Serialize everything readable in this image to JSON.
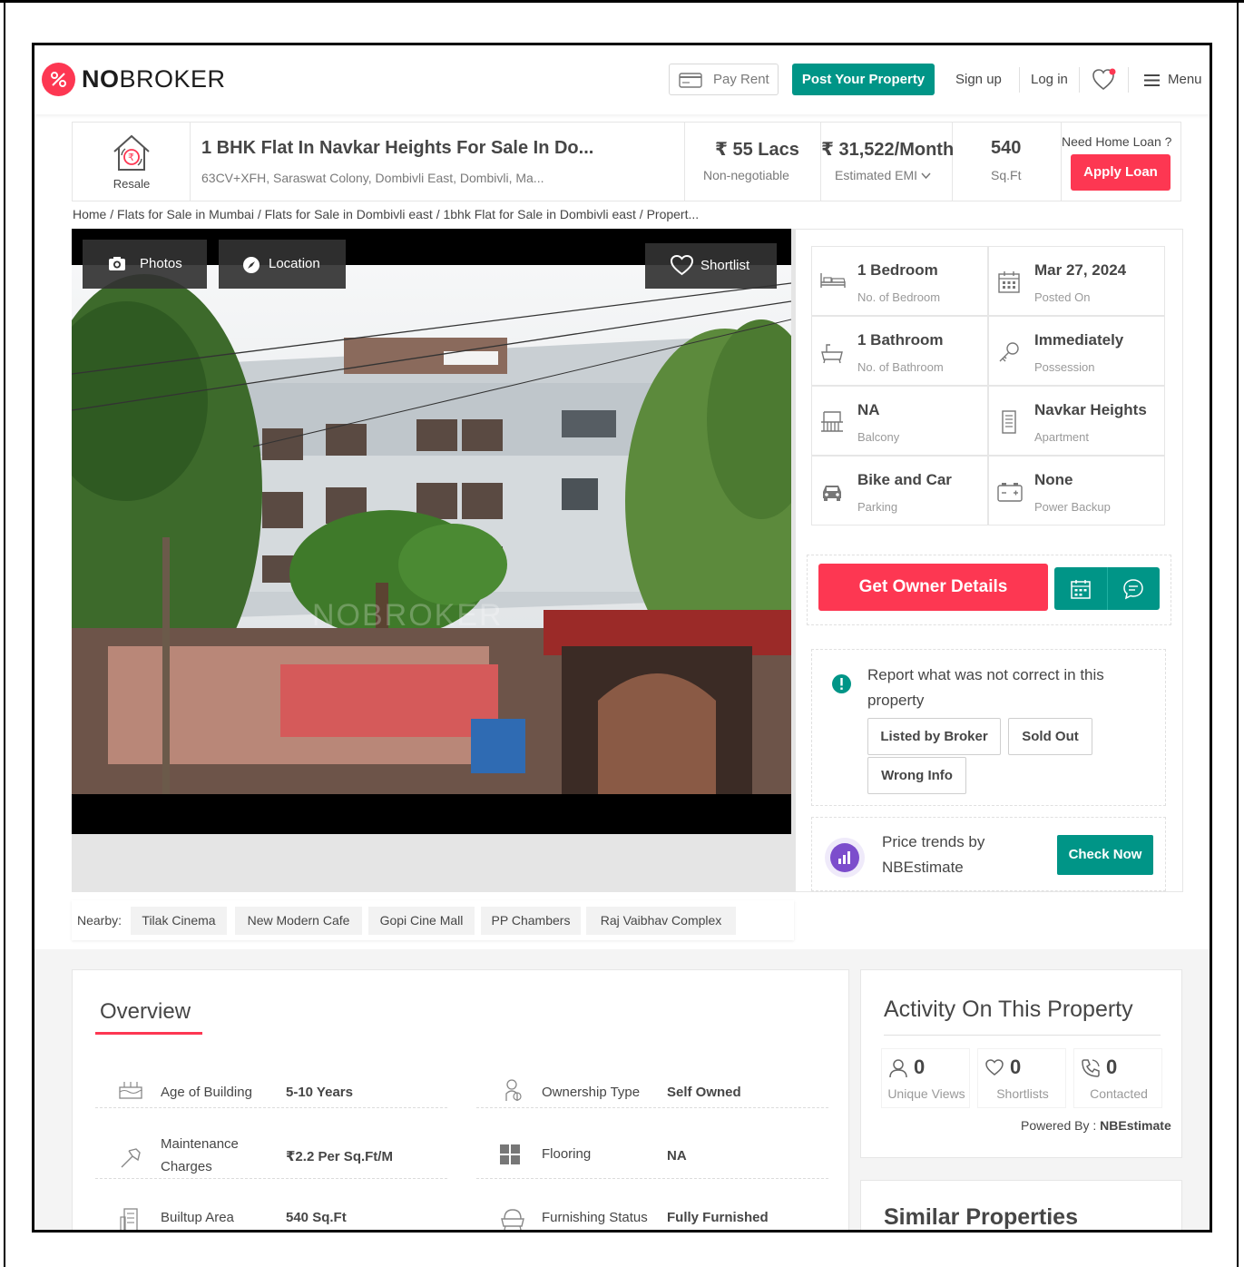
{
  "header": {
    "logo": "NOBROKER",
    "logo_bold": "NO",
    "logo_rest": "BROKER",
    "pay_rent": "Pay Rent",
    "post_property": "Post Your Property",
    "sign_up": "Sign up",
    "log_in": "Log in",
    "menu": "Menu"
  },
  "property": {
    "type_badge": "Resale",
    "title": "1 BHK Flat In Navkar Heights For Sale In Do...",
    "address": "63CV+XFH, Saraswat Colony, Dombivli East, Dombivli, Ma...",
    "price": "₹ 55 Lacs",
    "price_note": "Non-negotiable",
    "emi": "₹ 31,522/Month",
    "emi_label": "Estimated EMI",
    "area": "540",
    "area_unit": "Sq.Ft",
    "loan_question": "Need Home Loan ?",
    "apply_loan": "Apply Loan"
  },
  "breadcrumb": "Home / Flats for Sale in Mumbai / Flats for Sale in Dombivli east / 1bhk Flat for Sale in Dombivli east / Propert...",
  "photo": {
    "photos_btn": "Photos",
    "location_btn": "Location",
    "shortlist_btn": "Shortlist",
    "watermark": "NOBROKER"
  },
  "specs": [
    {
      "value": "1 Bedroom",
      "label": "No. of Bedroom",
      "icon": "bed-icon"
    },
    {
      "value": "Mar 27, 2024",
      "label": "Posted On",
      "icon": "calendar-icon"
    },
    {
      "value": "1 Bathroom",
      "label": "No. of Bathroom",
      "icon": "bathtub-icon"
    },
    {
      "value": "Immediately",
      "label": "Possession",
      "icon": "key-icon"
    },
    {
      "value": "NA",
      "label": "Balcony",
      "icon": "balcony-icon"
    },
    {
      "value": "Navkar Heights",
      "label": "Apartment",
      "icon": "building-icon"
    },
    {
      "value": "Bike and Car",
      "label": "Parking",
      "icon": "car-icon"
    },
    {
      "value": "None",
      "label": "Power Backup",
      "icon": "battery-icon"
    }
  ],
  "cta": {
    "owner_details": "Get Owner Details"
  },
  "report": {
    "text": "Report what was not correct in this property",
    "options": [
      "Listed by Broker",
      "Sold Out",
      "Wrong Info"
    ]
  },
  "trends": {
    "text_line1": "Price trends by",
    "text_line2": "NBEstimate",
    "check_now": "Check Now"
  },
  "nearby": {
    "label": "Nearby:",
    "places": [
      "Tilak Cinema",
      "New Modern Cafe",
      "Gopi Cine Mall",
      "PP Chambers",
      "Raj Vaibhav Complex"
    ]
  },
  "overview": {
    "title": "Overview",
    "rows": [
      {
        "label": "Age of Building",
        "value": "5-10 Years",
        "icon": "building-age-icon"
      },
      {
        "label": "Ownership Type",
        "value": "Self Owned",
        "icon": "owner-icon"
      },
      {
        "label": "Maintenance Charges",
        "label_l1": "Maintenance",
        "label_l2": "Charges",
        "value": "₹2.2 Per Sq.Ft/M",
        "icon": "hammer-icon"
      },
      {
        "label": "Flooring",
        "value": "NA",
        "icon": "flooring-icon"
      },
      {
        "label": "Builtup Area",
        "value": "540 Sq.Ft",
        "icon": "area-icon"
      },
      {
        "label": "Furnishing Status",
        "value": "Fully Furnished",
        "icon": "sofa-icon"
      }
    ]
  },
  "activity": {
    "title": "Activity On This Property",
    "items": [
      {
        "count": "0",
        "label": "Unique Views",
        "icon": "user-icon"
      },
      {
        "count": "0",
        "label": "Shortlists",
        "icon": "heart-icon"
      },
      {
        "count": "0",
        "label": "Contacted",
        "icon": "phone-icon"
      }
    ],
    "powered_by_label": "Powered By :",
    "powered_by": "NBEstimate"
  },
  "similar": {
    "title": "Similar Properties"
  },
  "colors": {
    "brand_red": "#fd3752",
    "brand_teal": "#009587",
    "trend_purple": "#7c4dcc"
  }
}
